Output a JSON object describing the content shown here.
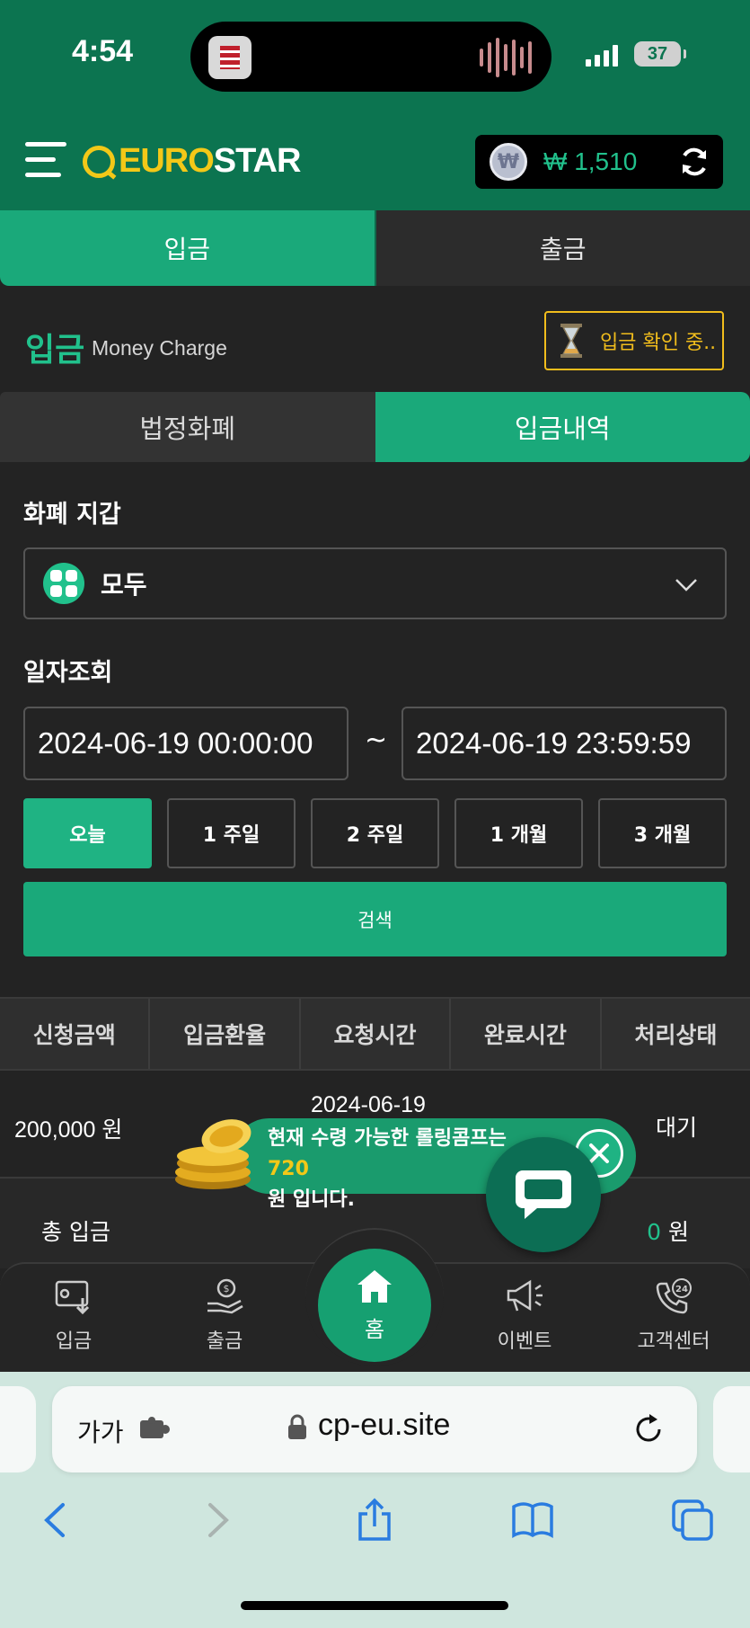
{
  "status": {
    "time": "4:54",
    "battery": "37"
  },
  "header": {
    "logo_euro": "EURO",
    "logo_star": "STAR",
    "currency_symbol": "₩",
    "balance": "₩ 1,510"
  },
  "main_tabs": {
    "deposit": "입금",
    "withdraw": "출금"
  },
  "section": {
    "title": "입금",
    "subtitle": "Money Charge",
    "pending_label": "입금 확인 중.."
  },
  "sub_tabs": {
    "fiat": "법정화폐",
    "history": "입금내역"
  },
  "wallet_select": {
    "label": "화폐 지갑",
    "value": "모두"
  },
  "date_filter": {
    "label": "일자조회",
    "start": "2024-06-19 00:00:00",
    "end": "2024-06-19 23:59:59",
    "separator": "~",
    "periods": [
      "오늘",
      "1 주일",
      "2 주일",
      "1 개월",
      "3 개월"
    ]
  },
  "search_label": "검색",
  "table": {
    "headers": [
      "신청금액",
      "입금환율",
      "요청시간",
      "완료시간",
      "처리상태"
    ],
    "rows": [
      {
        "amount": "200,000 원",
        "request_time": "2024-06-19",
        "status": "대기"
      }
    ]
  },
  "summary": {
    "label": "총 입금",
    "value": "0",
    "unit": "원"
  },
  "notice": {
    "line1": "현재 수령 가능한 롤링콤프는",
    "number": "720",
    "line2": "원 입니다."
  },
  "bottom_nav": {
    "deposit": "입금",
    "withdraw": "출금",
    "home": "홈",
    "event": "이벤트",
    "support": "고객센터"
  },
  "browser": {
    "aa": "가가",
    "url": "cp-eu.site"
  },
  "colors": {
    "brand_green": "#0c7450",
    "accent_green": "#1aa97a",
    "warning_yellow": "#f1bd1c"
  }
}
